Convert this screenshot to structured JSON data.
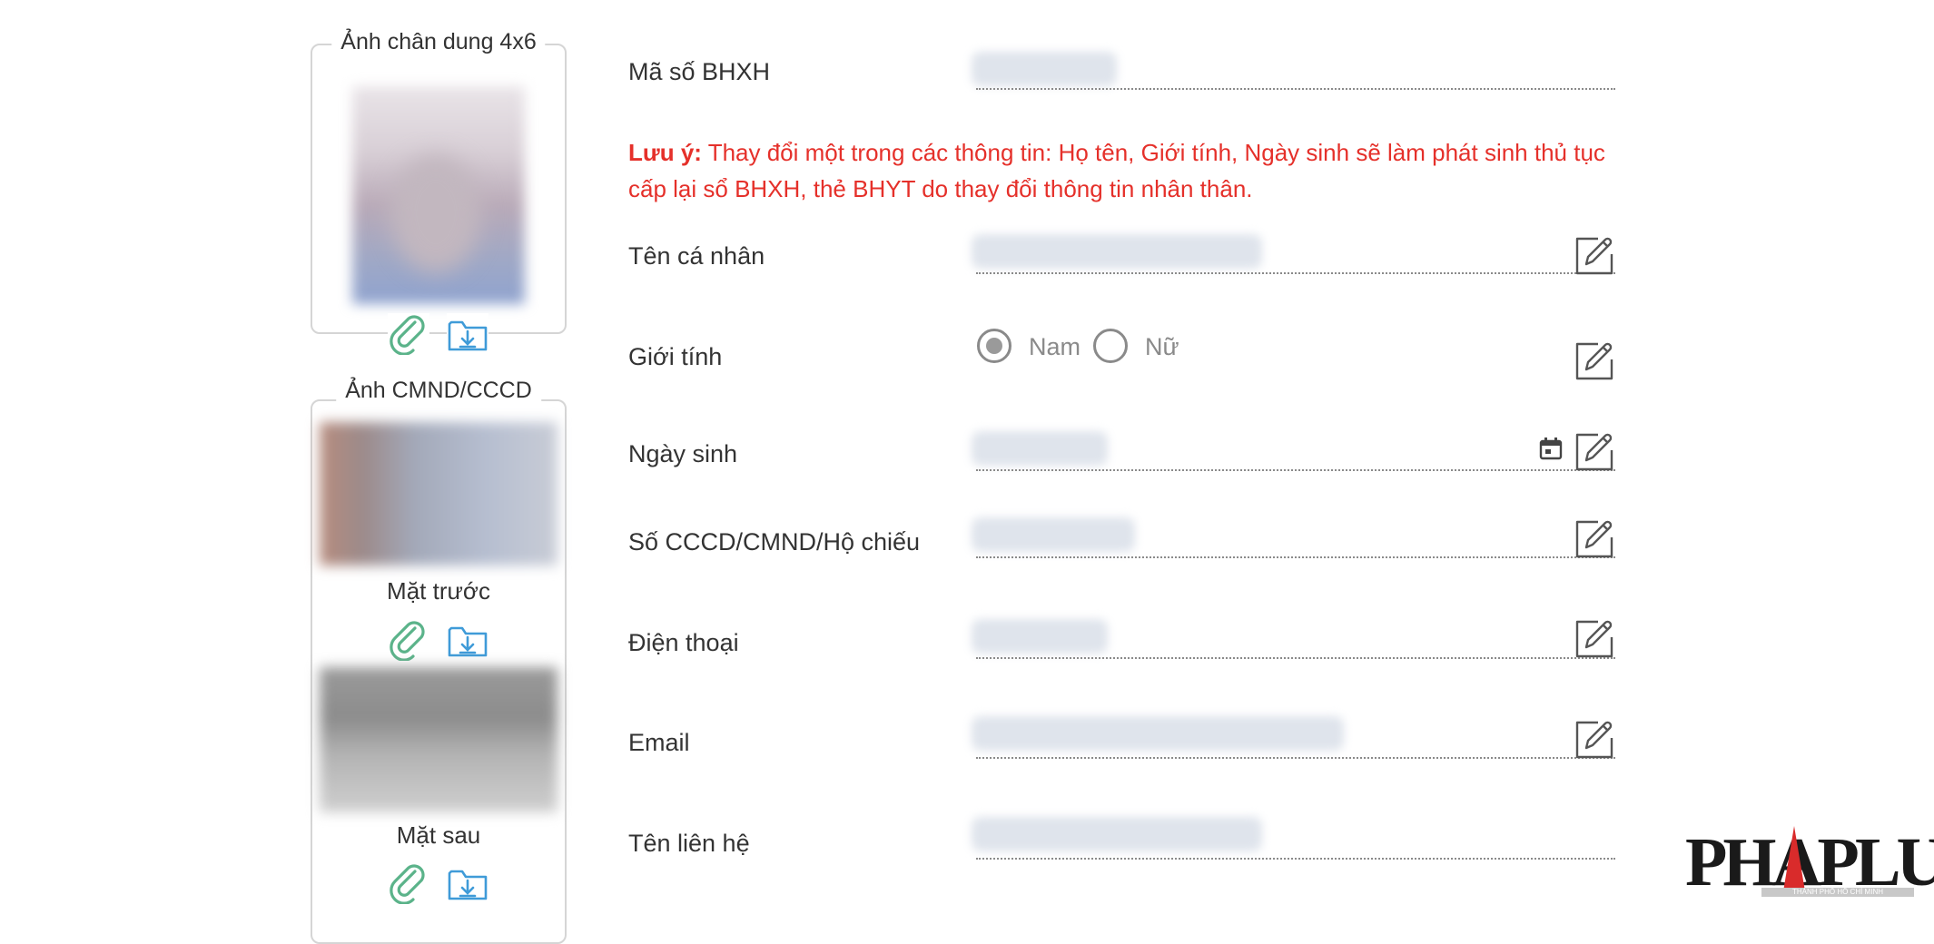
{
  "photos": {
    "portrait_legend": "Ảnh chân dung 4x6",
    "id_legend": "Ảnh CMND/CCCD",
    "front_caption": "Mặt trước",
    "back_caption": "Mặt sau",
    "attach_icon": "paperclip-icon",
    "download_icon": "folder-download-icon"
  },
  "form": {
    "social_insurance_label": "Mã số BHXH",
    "note_prefix": "Lưu ý:",
    "note_text": " Thay đổi một trong các thông tin: Họ tên, Giới tính, Ngày sinh sẽ làm phát sinh thủ tục cấp lại sổ BHXH, thẻ BHYT do thay đổi thông tin nhân thân.",
    "name_label": "Tên cá nhân",
    "gender_label": "Giới tính",
    "gender_options": [
      "Nam",
      "Nữ"
    ],
    "gender_selected": "Nam",
    "dob_label": "Ngày sinh",
    "id_number_label": "Số CCCD/CMND/Hộ chiếu",
    "phone_label": "Điện thoại",
    "email_label": "Email",
    "contact_name_label": "Tên liên hệ",
    "edit_icon": "edit-icon",
    "calendar_icon": "calendar-icon"
  },
  "watermark": {
    "logo_text": "PHAPLUAT",
    "logo_subtext": "THÀNH PHỐ HỒ CHÍ MINH"
  },
  "colors": {
    "note_red": "#e5302a",
    "attach_green": "#5bb38a",
    "download_blue": "#3f9bd8",
    "border_gray": "#d5d5d5"
  }
}
